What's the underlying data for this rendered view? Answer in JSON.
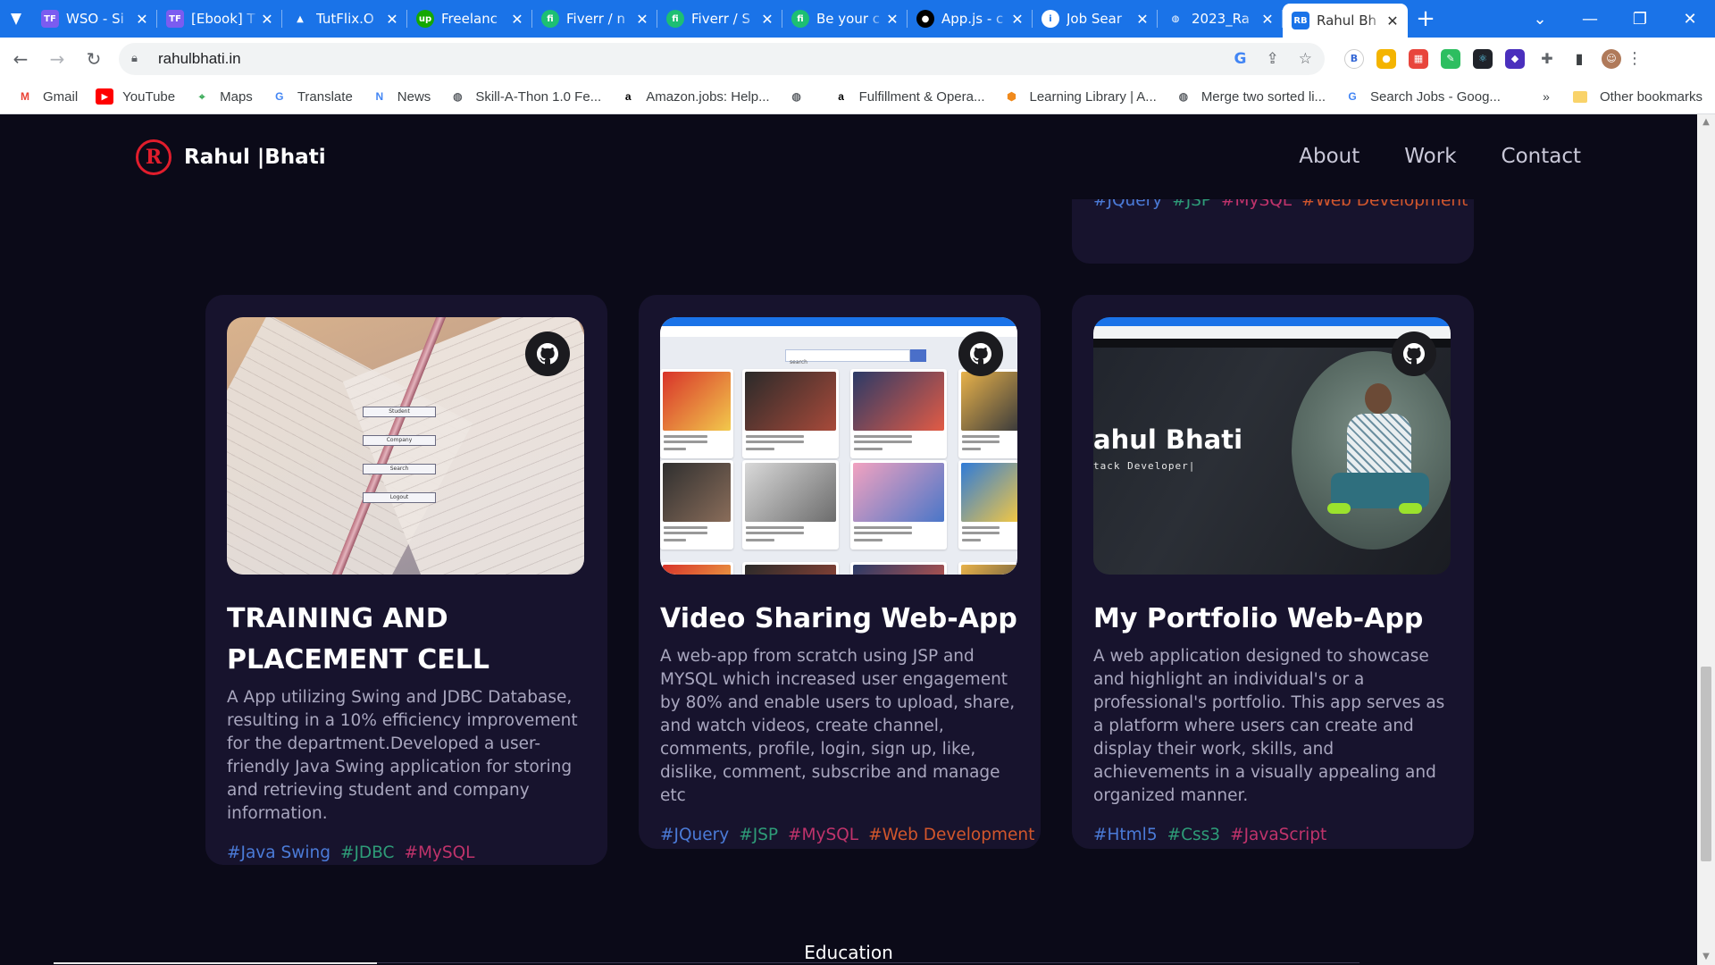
{
  "browser": {
    "tabs": [
      {
        "title": "WSO - Si",
        "favicon": "TF",
        "favicon_color": "#7b5cf0"
      },
      {
        "title": "[Ebook] T",
        "favicon": "TF",
        "favicon_color": "#7b5cf0"
      },
      {
        "title": "TutFlix.O",
        "favicon": "drive-icon",
        "favicon_color": "#fbbc04"
      },
      {
        "title": "Freelanc",
        "favicon": "up",
        "favicon_color": "#14a800"
      },
      {
        "title": "Fiverr / n",
        "favicon": "fi",
        "favicon_color": "#1dbf73"
      },
      {
        "title": "Fiverr / S",
        "favicon": "fi",
        "favicon_color": "#1dbf73"
      },
      {
        "title": "Be your c",
        "favicon": "fi",
        "favicon_color": "#1dbf73"
      },
      {
        "title": "App.js - c",
        "favicon": "github-icon",
        "favicon_color": "#000000"
      },
      {
        "title": "Job Sear",
        "favicon": "info-icon",
        "favicon_color": "#1a73e8"
      },
      {
        "title": "2023_Ra",
        "favicon": "globe-icon",
        "favicon_color": "#5f6368"
      },
      {
        "title": "Rahul Bh",
        "favicon": "RB",
        "favicon_color": "#1a73e8",
        "active": true
      }
    ],
    "url": "rahulbhati.in",
    "bookmarks": [
      {
        "label": "Gmail",
        "icon": "gmail-icon",
        "color": "#ea4335"
      },
      {
        "label": "YouTube",
        "icon": "youtube-icon",
        "color": "#ff0000"
      },
      {
        "label": "Maps",
        "icon": "maps-icon",
        "color": "#34a853"
      },
      {
        "label": "Translate",
        "icon": "translate-icon",
        "color": "#4285f4"
      },
      {
        "label": "News",
        "icon": "news-icon",
        "color": "#4285f4"
      },
      {
        "label": "Skill-A-Thon 1.0 Fe...",
        "icon": "globe-icon",
        "color": "#5f6368"
      },
      {
        "label": "Amazon.jobs: Help...",
        "icon": "amazon-icon",
        "color": "#000000"
      },
      {
        "label": "",
        "icon": "globe-icon",
        "color": "#5f6368"
      },
      {
        "label": "Fulfillment & Opera...",
        "icon": "amazon-icon",
        "color": "#000000"
      },
      {
        "label": "Learning Library | A...",
        "icon": "box-icon",
        "color": "#f08a1c"
      },
      {
        "label": "Merge two sorted li...",
        "icon": "globe-icon",
        "color": "#5f6368"
      },
      {
        "label": "Search Jobs - Goog...",
        "icon": "google-icon",
        "color": "#4285f4"
      }
    ],
    "bookmarks_more": "»",
    "other_bookmarks": "Other bookmarks"
  },
  "site": {
    "logo_letter": "R",
    "logo_text": "Rahul |Bhati",
    "nav": [
      "About",
      "Work",
      "Contact"
    ]
  },
  "top_partial_card": {
    "tags": [
      "#JQuery",
      "#JSP",
      "#MySQL",
      "#Web Development"
    ]
  },
  "projects": [
    {
      "title": "TRAINING AND PLACEMENT CELL",
      "description": "A App utilizing Swing and JDBC Database, resulting in a 10% efficiency improvement for the department.Developed a user- friendly Java Swing application for storing and retrieving student and company information.",
      "tags": [
        "#Java Swing",
        "#JDBC",
        "#MySQL"
      ],
      "thumb_buttons": [
        "Student",
        "Company",
        "Search",
        "Logout"
      ]
    },
    {
      "title": "Video Sharing Web-App",
      "description": "A web-app from scratch using JSP and MYSQL which increased user engagement by 80% and enable users to upload, share, and watch videos, create channel, comments, profile, login, sign up, like, dislike, comment, subscribe and manage etc",
      "tags": [
        "#JQuery",
        "#JSP",
        "#MySQL",
        "#Web Development"
      ],
      "thumb_search": "search"
    },
    {
      "title": "My Portfolio Web-App",
      "description": "A web application designed to showcase and highlight an individual's or a professional's portfolio. This app serves as a platform where users can create and display their work, skills, and achievements in a visually appealing and organized manner.",
      "tags": [
        "#Html5",
        "#Css3",
        "#JavaScript"
      ],
      "thumb_name": "ahul Bhati",
      "thumb_sub": "tack Developer|"
    }
  ],
  "next_section": "Education",
  "colors": {
    "page_bg": "#0b0a18",
    "card_bg": "#17132d",
    "tag_blue": "#4b7bd8",
    "tag_green": "#2e9c78",
    "tag_pink": "#c0336b",
    "tag_orange": "#d1562c",
    "logo_red": "#e11d2c"
  }
}
